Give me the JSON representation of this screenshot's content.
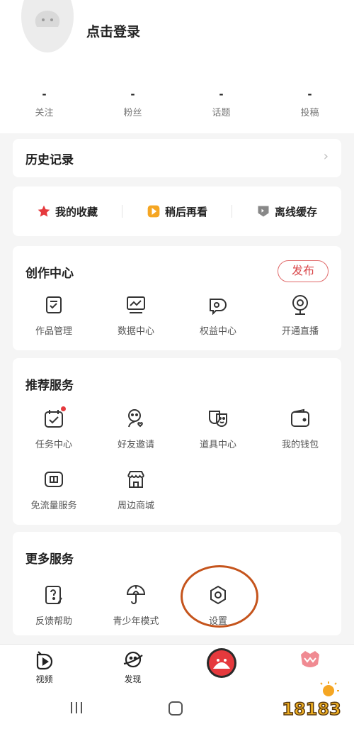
{
  "profile": {
    "login_text": "点击登录"
  },
  "stats": [
    {
      "value": "-",
      "label": "关注"
    },
    {
      "value": "-",
      "label": "粉丝"
    },
    {
      "value": "-",
      "label": "话题"
    },
    {
      "value": "-",
      "label": "投稿"
    }
  ],
  "history": {
    "title": "历史记录"
  },
  "quick": [
    {
      "label": "我的收藏",
      "icon": "star-icon",
      "color": "#e5393d"
    },
    {
      "label": "稍后再看",
      "icon": "watch-later-icon",
      "color": "#f5a623"
    },
    {
      "label": "离线缓存",
      "icon": "download-icon",
      "color": "#777777"
    }
  ],
  "create": {
    "title": "创作中心",
    "publish_label": "发布",
    "items": [
      {
        "label": "作品管理",
        "icon": "works-icon"
      },
      {
        "label": "数据中心",
        "icon": "data-chart-icon"
      },
      {
        "label": "权益中心",
        "icon": "benefits-icon"
      },
      {
        "label": "开通直播",
        "icon": "live-camera-icon"
      }
    ]
  },
  "recommend": {
    "title": "推荐服务",
    "items": [
      {
        "label": "任务中心",
        "icon": "calendar-check-icon",
        "badge": true
      },
      {
        "label": "好友邀请",
        "icon": "invite-friend-icon"
      },
      {
        "label": "道具中心",
        "icon": "mask-icon"
      },
      {
        "label": "我的钱包",
        "icon": "wallet-icon"
      },
      {
        "label": "免流量服务",
        "icon": "data-free-icon"
      },
      {
        "label": "周边商城",
        "icon": "store-icon"
      }
    ]
  },
  "more": {
    "title": "更多服务",
    "items": [
      {
        "label": "反馈帮助",
        "icon": "feedback-help-icon"
      },
      {
        "label": "青少年模式",
        "icon": "umbrella-icon"
      },
      {
        "label": "设置",
        "icon": "settings-icon"
      }
    ]
  },
  "tabs": [
    {
      "label": "视频",
      "icon": "video-icon"
    },
    {
      "label": "发现",
      "icon": "planet-icon"
    },
    {
      "label": "",
      "icon": "center-mascot-icon"
    },
    {
      "label": "",
      "icon": "profile-mascot-icon"
    }
  ],
  "watermark": {
    "text": "18183"
  },
  "colors": {
    "accent": "#e5393d",
    "highlight_ring": "#c5541c",
    "background": "#f5f5f5"
  }
}
